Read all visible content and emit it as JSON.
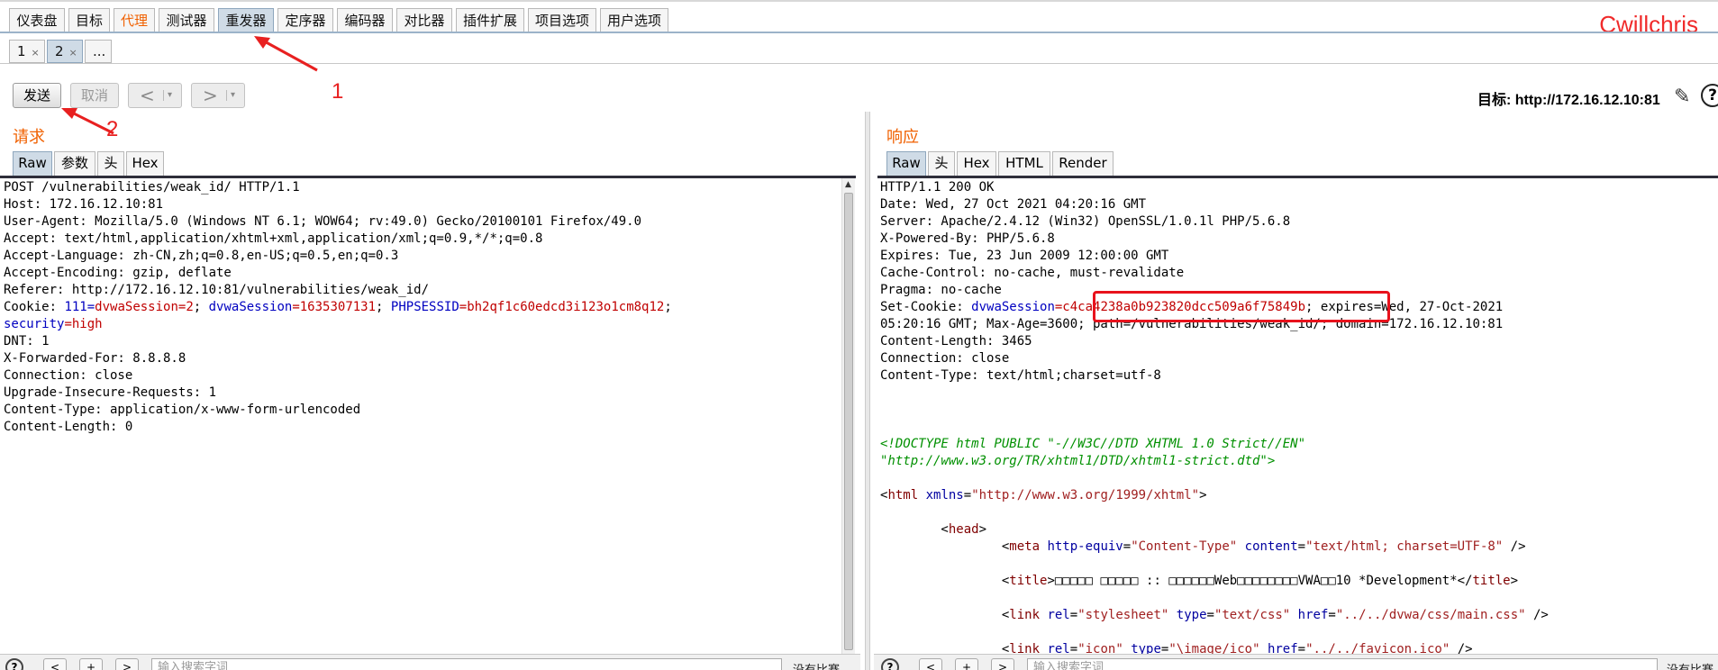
{
  "top_tabs": [
    {
      "label": "仪表盘"
    },
    {
      "label": "目标"
    },
    {
      "label": "代理"
    },
    {
      "label": "测试器"
    },
    {
      "label": "重发器"
    },
    {
      "label": "定序器"
    },
    {
      "label": "编码器"
    },
    {
      "label": "对比器"
    },
    {
      "label": "插件扩展"
    },
    {
      "label": "项目选项"
    },
    {
      "label": "用户选项"
    }
  ],
  "brand": "Cwillchris",
  "sub_tabs": [
    {
      "label": "1",
      "close": "×"
    },
    {
      "label": "2",
      "close": "×"
    },
    {
      "label": "..."
    }
  ],
  "toolbar": {
    "send_label": "发送",
    "cancel_label": "取消",
    "prev_label": "<",
    "next_label": ">",
    "dropdown": "▾",
    "target_text": "目标: http://172.16.12.10:81",
    "help": "?"
  },
  "request": {
    "heading": "请求",
    "tabs": [
      "Raw",
      "参数",
      "头",
      "Hex"
    ],
    "lines": [
      [
        {
          "t": "POST /vulnerabilities/weak_id/ HTTP/1.1"
        }
      ],
      [
        {
          "t": "Host: 172.16.12.10:81"
        }
      ],
      [
        {
          "t": "User-Agent: Mozilla/5.0 (Windows NT 6.1; WOW64; rv:49.0) Gecko/20100101 Firefox/49.0"
        }
      ],
      [
        {
          "t": "Accept: text/html,application/xhtml+xml,application/xml;q=0.9,*/*;q=0.8"
        }
      ],
      [
        {
          "t": "Accept-Language: zh-CN,zh;q=0.8,en-US;q=0.5,en;q=0.3"
        }
      ],
      [
        {
          "t": "Accept-Encoding: gzip, deflate"
        }
      ],
      [
        {
          "t": "Referer: http://172.16.12.10:81/vulnerabilities/weak_id/"
        }
      ],
      [
        {
          "t": "Cookie: "
        },
        {
          "t": "111",
          "c": "k"
        },
        {
          "t": "=",
          "c": "k"
        },
        {
          "t": "dvwaSession=2",
          "c": "v"
        },
        {
          "t": "; "
        },
        {
          "t": "dvwaSession",
          "c": "k"
        },
        {
          "t": "=1635307131",
          "c": "v"
        },
        {
          "t": "; "
        },
        {
          "t": "PHPSESSID",
          "c": "k"
        },
        {
          "t": "=bh2qf1c60edcd3i123o1cm8q12",
          "c": "v"
        },
        {
          "t": ";"
        }
      ],
      [
        {
          "t": "security",
          "c": "k"
        },
        {
          "t": "=high",
          "c": "v"
        }
      ],
      [
        {
          "t": "DNT: 1"
        }
      ],
      [
        {
          "t": "X-Forwarded-For: 8.8.8.8"
        }
      ],
      [
        {
          "t": "Connection: close"
        }
      ],
      [
        {
          "t": "Upgrade-Insecure-Requests: 1"
        }
      ],
      [
        {
          "t": "Content-Type: application/x-www-form-urlencoded"
        }
      ],
      [
        {
          "t": "Content-Length: 0"
        }
      ]
    ]
  },
  "response": {
    "heading": "响应",
    "tabs": [
      "Raw",
      "头",
      "Hex",
      "HTML",
      "Render"
    ],
    "lines": [
      [
        {
          "t": "HTTP/1.1 200 OK"
        }
      ],
      [
        {
          "t": "Date: Wed, 27 Oct 2021 04:20:16 GMT"
        }
      ],
      [
        {
          "t": "Server: Apache/2.4.12 (Win32) OpenSSL/1.0.1l PHP/5.6.8"
        }
      ],
      [
        {
          "t": "X-Powered-By: PHP/5.6.8"
        }
      ],
      [
        {
          "t": "Expires: Tue, 23 Jun 2009 12:00:00 GMT"
        }
      ],
      [
        {
          "t": "Cache-Control: no-cache, must-revalidate"
        }
      ],
      [
        {
          "t": "Pragma: no-cache"
        }
      ],
      [
        {
          "t": "Set-Cookie: "
        },
        {
          "t": "dvwaSession",
          "c": "k"
        },
        {
          "t": "=c4ca4238a0b923820dcc509a6f75849b",
          "c": "v"
        },
        {
          "t": "; expires=Wed, 27-Oct-2021"
        }
      ],
      [
        {
          "t": "05:20:16 GMT; Max-Age=3600; path=/vulnerabilities/weak_id/; domain=172.16.12.10:81"
        }
      ],
      [
        {
          "t": "Content-Length: 3465"
        }
      ],
      [
        {
          "t": "Connection: close"
        }
      ],
      [
        {
          "t": "Content-Type: text/html;charset=utf-8"
        }
      ],
      [],
      [],
      [],
      [
        {
          "t": "<!DOCTYPE html PUBLIC \"-//W3C//DTD XHTML 1.0 Strict//EN\"",
          "c": "c"
        }
      ],
      [
        {
          "t": "\"http://www.w3.org/TR/xhtml1/DTD/xhtml1-strict.dtd\">",
          "c": "c"
        }
      ],
      [],
      [
        {
          "t": "<"
        },
        {
          "t": "html",
          "c": "t"
        },
        {
          "t": " "
        },
        {
          "t": "xmlns",
          "c": "a"
        },
        {
          "t": "="
        },
        {
          "t": "\"http://www.w3.org/1999/xhtml\"",
          "c": "s"
        },
        {
          "t": ">"
        }
      ],
      [],
      [
        {
          "t": "        <"
        },
        {
          "t": "head",
          "c": "t"
        },
        {
          "t": ">"
        }
      ],
      [
        {
          "t": "                <"
        },
        {
          "t": "meta",
          "c": "t"
        },
        {
          "t": " "
        },
        {
          "t": "http-equiv",
          "c": "a"
        },
        {
          "t": "="
        },
        {
          "t": "\"Content-Type\"",
          "c": "s"
        },
        {
          "t": " "
        },
        {
          "t": "content",
          "c": "a"
        },
        {
          "t": "="
        },
        {
          "t": "\"text/html; charset=UTF-8\"",
          "c": "s"
        },
        {
          "t": " />"
        }
      ],
      [],
      [
        {
          "t": "                <"
        },
        {
          "t": "title",
          "c": "t"
        },
        {
          "t": ">□□□□□ □□□□□ :: □□□□□□Web□□□□□□□□VWA□□10 *Development*</"
        },
        {
          "t": "title",
          "c": "t"
        },
        {
          "t": ">"
        }
      ],
      [],
      [
        {
          "t": "                <"
        },
        {
          "t": "link",
          "c": "t"
        },
        {
          "t": " "
        },
        {
          "t": "rel",
          "c": "a"
        },
        {
          "t": "="
        },
        {
          "t": "\"stylesheet\"",
          "c": "s"
        },
        {
          "t": " "
        },
        {
          "t": "type",
          "c": "a"
        },
        {
          "t": "="
        },
        {
          "t": "\"text/css\"",
          "c": "s"
        },
        {
          "t": " "
        },
        {
          "t": "href",
          "c": "a"
        },
        {
          "t": "="
        },
        {
          "t": "\"../../dvwa/css/main.css\"",
          "c": "s"
        },
        {
          "t": " />"
        }
      ],
      [],
      [
        {
          "t": "                <"
        },
        {
          "t": "link",
          "c": "t"
        },
        {
          "t": " "
        },
        {
          "t": "rel",
          "c": "a"
        },
        {
          "t": "="
        },
        {
          "t": "\"icon\"",
          "c": "s"
        },
        {
          "t": " "
        },
        {
          "t": "type",
          "c": "a"
        },
        {
          "t": "="
        },
        {
          "t": "\"\\image/ico\"",
          "c": "s"
        },
        {
          "t": " "
        },
        {
          "t": "href",
          "c": "a"
        },
        {
          "t": "="
        },
        {
          "t": "\"../../favicon.ico\"",
          "c": "s"
        },
        {
          "t": " />"
        }
      ]
    ]
  },
  "bottom": {
    "help": "?",
    "buttons": [
      "<",
      "+",
      ">"
    ],
    "search_placeholder": "输入搜索字词",
    "match_count": "没有比赛"
  },
  "annotations": {
    "label_1": "1",
    "label_2": "2",
    "highlight_color": "#e8121c",
    "accent_color": "#f06000"
  }
}
